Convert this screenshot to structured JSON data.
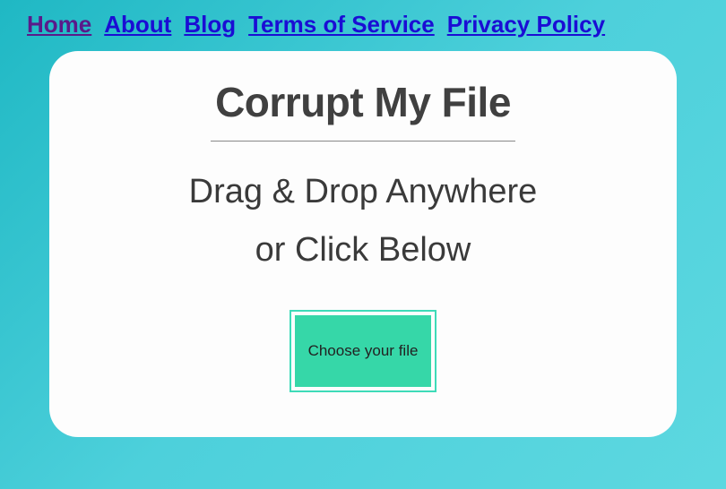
{
  "nav": {
    "items": [
      {
        "label": "Home",
        "visited": true
      },
      {
        "label": "About",
        "visited": false
      },
      {
        "label": "Blog",
        "visited": false
      },
      {
        "label": "Terms of Service",
        "visited": false
      },
      {
        "label": "Privacy Policy",
        "visited": false
      }
    ]
  },
  "card": {
    "title": "Corrupt My File",
    "subtitle_line1": "Drag & Drop Anywhere",
    "subtitle_line2": "or Click Below",
    "choose_label": "Choose your file"
  }
}
